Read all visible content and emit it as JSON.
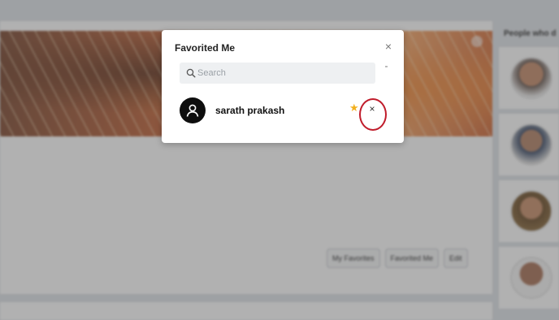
{
  "background": {
    "tabs": [
      "My Favorites",
      "Favorited Me",
      "Edit"
    ],
    "side_panel": {
      "title": "People who d"
    }
  },
  "modal": {
    "title": "Favorited Me",
    "close_glyph": "×",
    "search": {
      "placeholder": "Search",
      "value": ""
    },
    "users": [
      {
        "name": "sarath prakash",
        "favorite_icon": "star-icon",
        "remove_glyph": "×"
      }
    ]
  },
  "colors": {
    "highlight": "#c01b2a",
    "star": "#f2b01e",
    "avatar_bg": "#0e0e0e"
  }
}
